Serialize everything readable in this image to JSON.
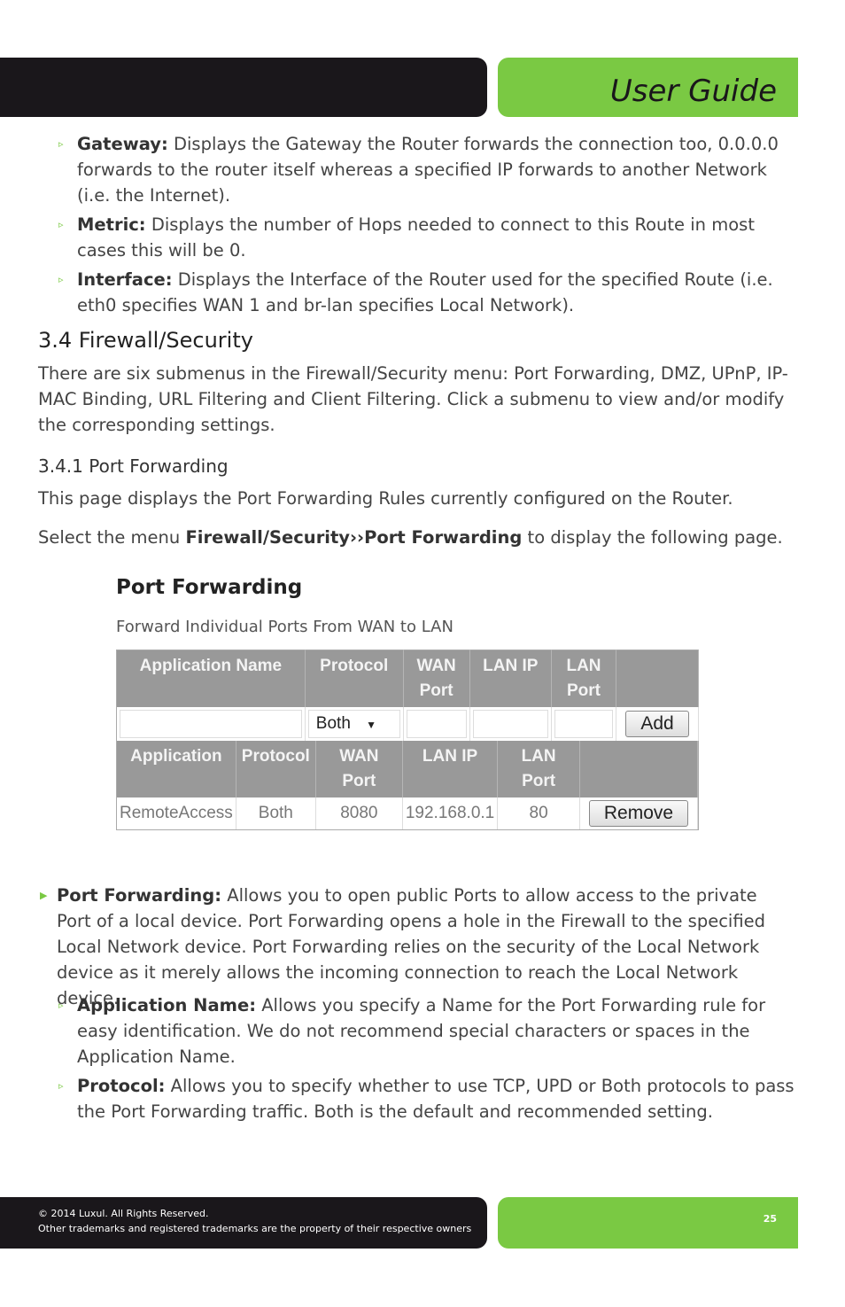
{
  "header": {
    "title": "User Guide"
  },
  "bullets_top": [
    {
      "term": "Gateway:",
      "text": " Displays the Gateway the Router forwards the connection too, 0.0.0.0 forwards to the router itself whereas a specified IP forwards to another Network (i.e. the Internet)."
    },
    {
      "term": "Metric:",
      "text": " Displays the number of Hops needed to connect to this Route in most cases this will be 0."
    },
    {
      "term": "Interface:",
      "text": " Displays the Interface of the Router used for the specified Route (i.e. eth0 specifies WAN 1 and br-lan specifies Local Network)."
    }
  ],
  "section": {
    "title": "3.4 Firewall/Security",
    "intro": "There are six submenus in the Firewall/Security menu: Port Forwarding, DMZ, UPnP, IP-MAC Binding, URL Filtering and Client Filtering. Click a submenu to view and/or modify the corresponding settings."
  },
  "subsection": {
    "title": "3.4.1 Port Forwarding",
    "p1": "This page displays the Port Forwarding Rules currently configured on the Router.",
    "p2_pre": "Select the menu ",
    "p2_bold": "Firewall/Security››Port Forwarding",
    "p2_post": " to display the following page."
  },
  "screenshot": {
    "title": "Port Forwarding",
    "subtitle": "Forward Individual Ports From WAN to LAN",
    "headers1": [
      "Application Name",
      "Protocol",
      "WAN Port",
      "LAN IP",
      "LAN Port"
    ],
    "protocol_value": "Both",
    "add_label": "Add",
    "headers2": [
      "Application",
      "Protocol",
      "WAN Port",
      "LAN IP",
      "LAN Port"
    ],
    "rows": [
      {
        "app": "RemoteAccess",
        "protocol": "Both",
        "wan_port": "8080",
        "lan_ip": "192.168.0.1",
        "lan_port": "80"
      }
    ],
    "remove_label": "Remove"
  },
  "main_bullet": {
    "term": "Port Forwarding:",
    "text": " Allows you to open public Ports to allow access to the private Port of a local device. Port Forwarding opens a hole in the Firewall to the specified Local Network device. Port Forwarding relies on the security of the Local Network device as it merely allows the incoming connection to reach the Local Network device."
  },
  "bullets_bottom": [
    {
      "term": "Application Name:",
      "text": " Allows you specify a Name for the Port Forwarding rule for easy identification. We do not recommend special characters or spaces in the Application Name."
    },
    {
      "term": "Protocol:",
      "text": " Allows you to specify whether to use TCP, UPD or Both protocols to pass the Port Forwarding traffic. Both is the default and recommended setting."
    }
  ],
  "footer": {
    "copyright": "© 2014  Luxul. All Rights Reserved.",
    "trademarks": "Other trademarks and registered trademarks are the property of their respective owners",
    "page_number": "25"
  },
  "colors": {
    "accent": "#7ac943",
    "dark": "#1a171b"
  }
}
